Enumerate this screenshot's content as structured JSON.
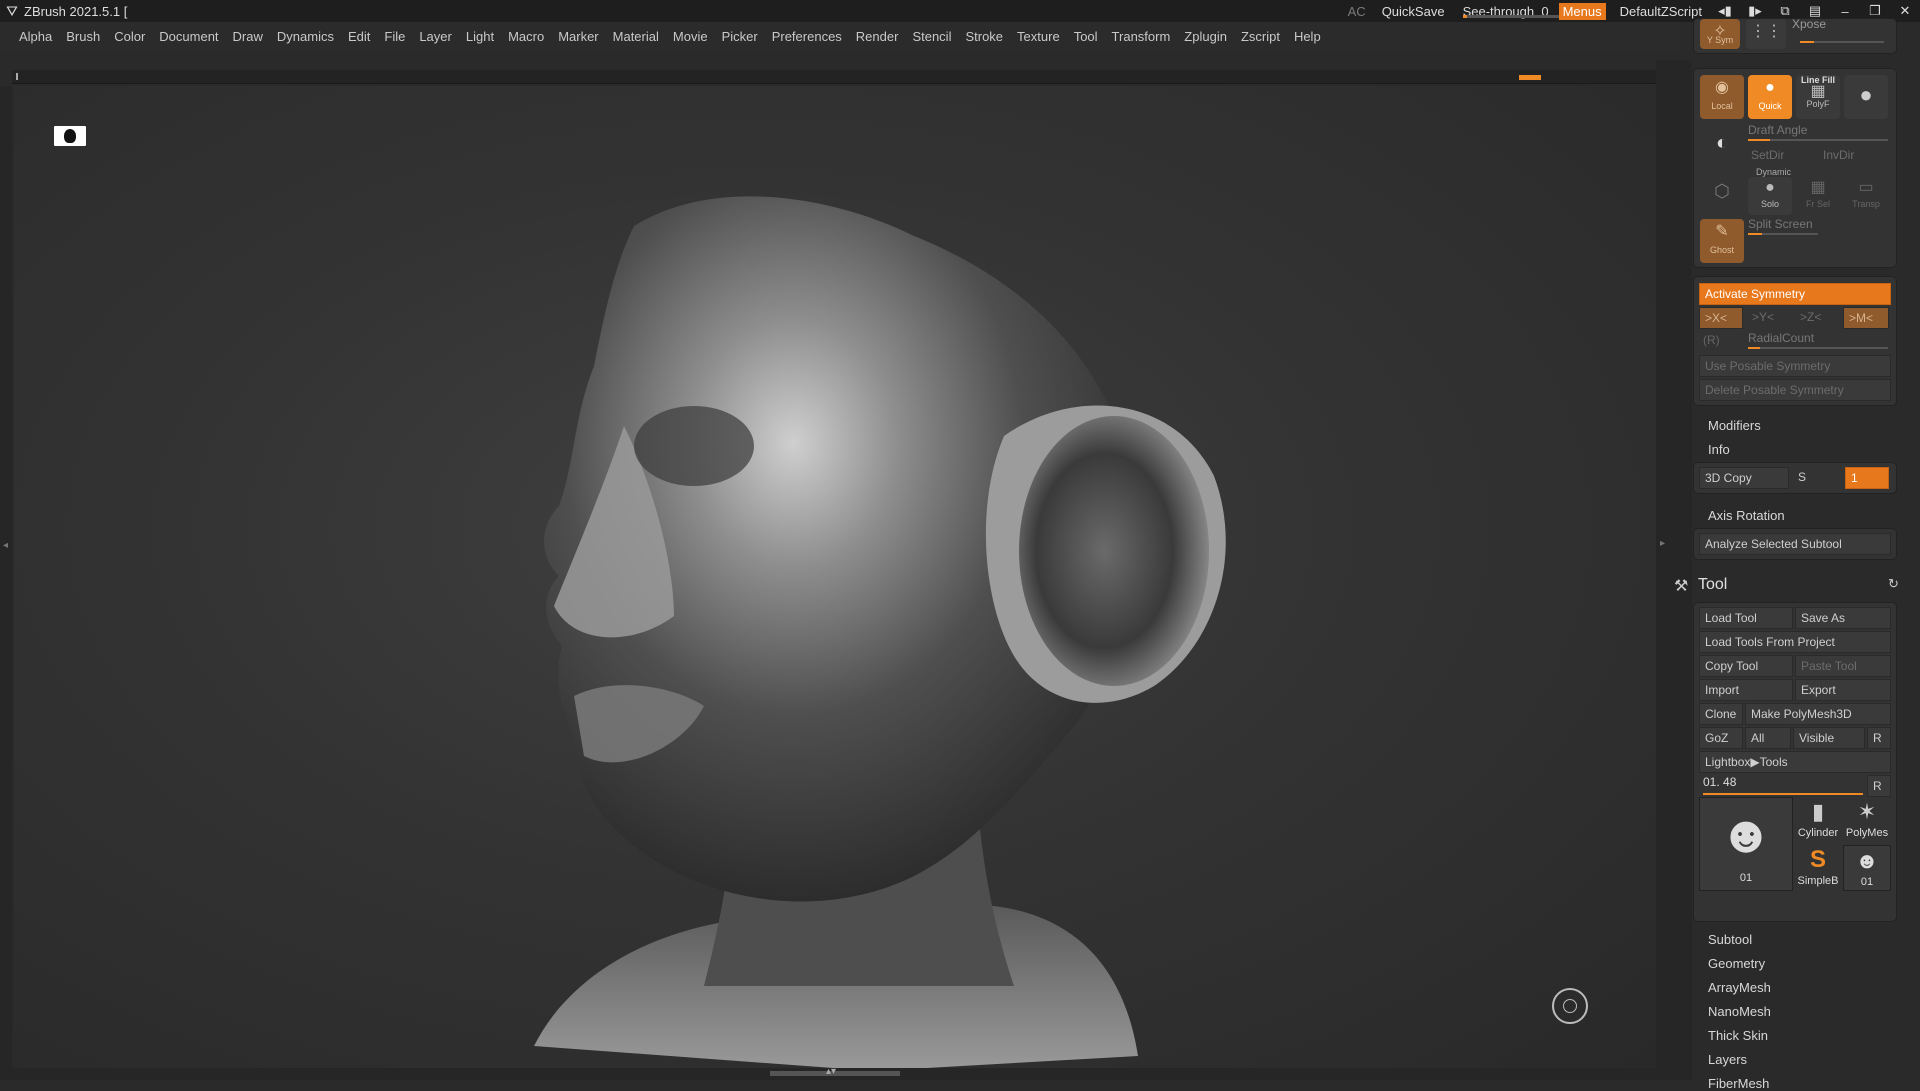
{
  "titlebar": {
    "title": "ZBrush 2021.5.1 [",
    "ac": "AC",
    "quicksave": "QuickSave",
    "seethrough_label": "See-through",
    "seethrough_value": "0",
    "seethrough_fraction": 0.0,
    "menus": "Menus",
    "script": "DefaultZScript"
  },
  "menubar": [
    "Alpha",
    "Brush",
    "Color",
    "Document",
    "Draw",
    "Dynamics",
    "Edit",
    "File",
    "Layer",
    "Light",
    "Macro",
    "Marker",
    "Material",
    "Movie",
    "Picker",
    "Preferences",
    "Render",
    "Stencil",
    "Stroke",
    "Texture",
    "Tool",
    "Transform",
    "Zplugin",
    "Zscript",
    "Help"
  ],
  "transform": {
    "ysym": "Y Sym",
    "xpose": "Xpose",
    "local": "Local",
    "quick": "Quick",
    "linefill": "Line Fill",
    "polyf": "PolyF",
    "draft_angle": "Draft Angle",
    "setdir": "SetDir",
    "invdir": "InvDir",
    "dynamic": "Dynamic",
    "solo": "Solo",
    "frsel": "Fr Sel",
    "transp": "Transp",
    "split_screen": "Split Screen",
    "ghost": "Ghost"
  },
  "symmetry": {
    "activate": "Activate Symmetry",
    "x": ">X<",
    "y": ">Y<",
    "z": ">Z<",
    "m": ">M<",
    "r": "(R)",
    "radial": "RadialCount",
    "use_posable": "Use Posable Symmetry",
    "delete_posable": "Delete Posable Symmetry"
  },
  "sections_top": [
    "Modifiers",
    "Info"
  ],
  "copy3d": {
    "label": "3D Copy",
    "s": "S",
    "value": "1"
  },
  "axis_rotation": "Axis Rotation",
  "analyze": "Analyze Selected Subtool",
  "tool": {
    "title": "Tool",
    "load_tool": "Load Tool",
    "save_as": "Save As",
    "load_from_project": "Load Tools From Project",
    "copy_tool": "Copy Tool",
    "paste_tool": "Paste Tool",
    "import": "Import",
    "export": "Export",
    "clone": "Clone",
    "make_polymesh": "Make PolyMesh3D",
    "goz": "GoZ",
    "all": "All",
    "visible": "Visible",
    "r": "R",
    "lightbox": "Lightbox▶Tools",
    "current": "01. 48",
    "current_r": "R",
    "thumbs": {
      "main": "01",
      "cylinder": "Cylinder",
      "polymesh": "PolyMes",
      "simpleb": "SimpleB",
      "small": "01"
    }
  },
  "sections_bottom": [
    "Subtool",
    "Geometry",
    "ArrayMesh",
    "NanoMesh",
    "Thick Skin",
    "Layers",
    "FiberMesh"
  ]
}
